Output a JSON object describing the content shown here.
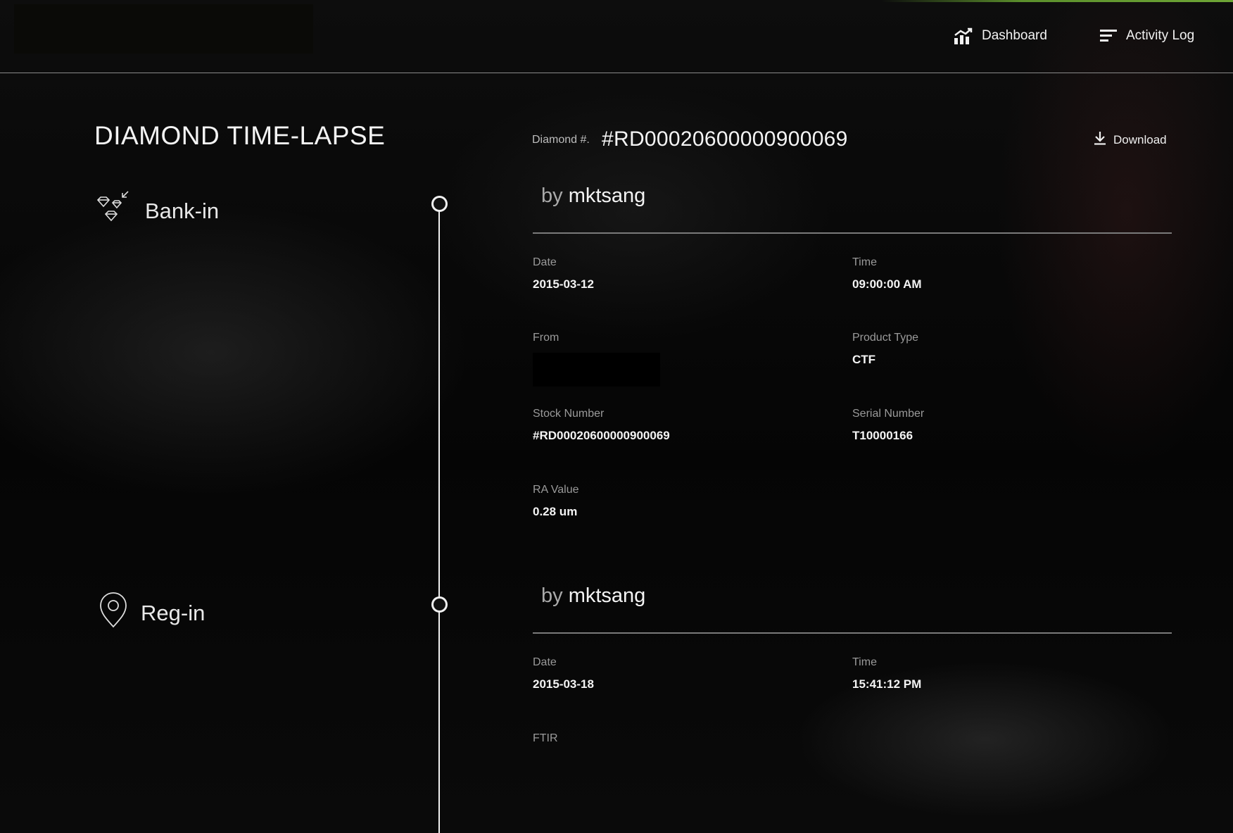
{
  "nav": {
    "dashboard_label": "Dashboard",
    "dashboard_icon": "bar-chart-icon",
    "activity_label": "Activity Log",
    "activity_icon": "list-icon"
  },
  "page": {
    "title": "DIAMOND TIME-LAPSE",
    "diamond_label": "Diamond #.",
    "diamond_id": "#RD00020600000900069",
    "download_label": "Download",
    "download_icon": "download-icon"
  },
  "stages": [
    {
      "label": "Bank-in",
      "icon": "diamonds-icon"
    },
    {
      "label": "Reg-in",
      "icon": "location-pin-icon"
    }
  ],
  "events": [
    {
      "by_prefix": "by",
      "user": "mktsang",
      "fields": {
        "date_label": "Date",
        "date": "2015-03-12",
        "time_label": "Time",
        "time": "09:00:00 AM",
        "from_label": "From",
        "product_type_label": "Product Type",
        "product_type": "CTF",
        "stock_number_label": "Stock Number",
        "stock_number": "#RD00020600000900069",
        "serial_number_label": "Serial Number",
        "serial_number": "T10000166",
        "ra_value_label": "RA Value",
        "ra_value": "0.28 um"
      }
    },
    {
      "by_prefix": "by",
      "user": "mktsang",
      "fields": {
        "date_label": "Date",
        "date": "2015-03-18",
        "time_label": "Time",
        "time": "15:41:12 PM",
        "ftir_label": "FTIR"
      }
    }
  ],
  "colors": {
    "background": "#000000",
    "text": "#f4f4f4",
    "muted": "#9a9a9a",
    "accent_green": "#6ea536"
  }
}
